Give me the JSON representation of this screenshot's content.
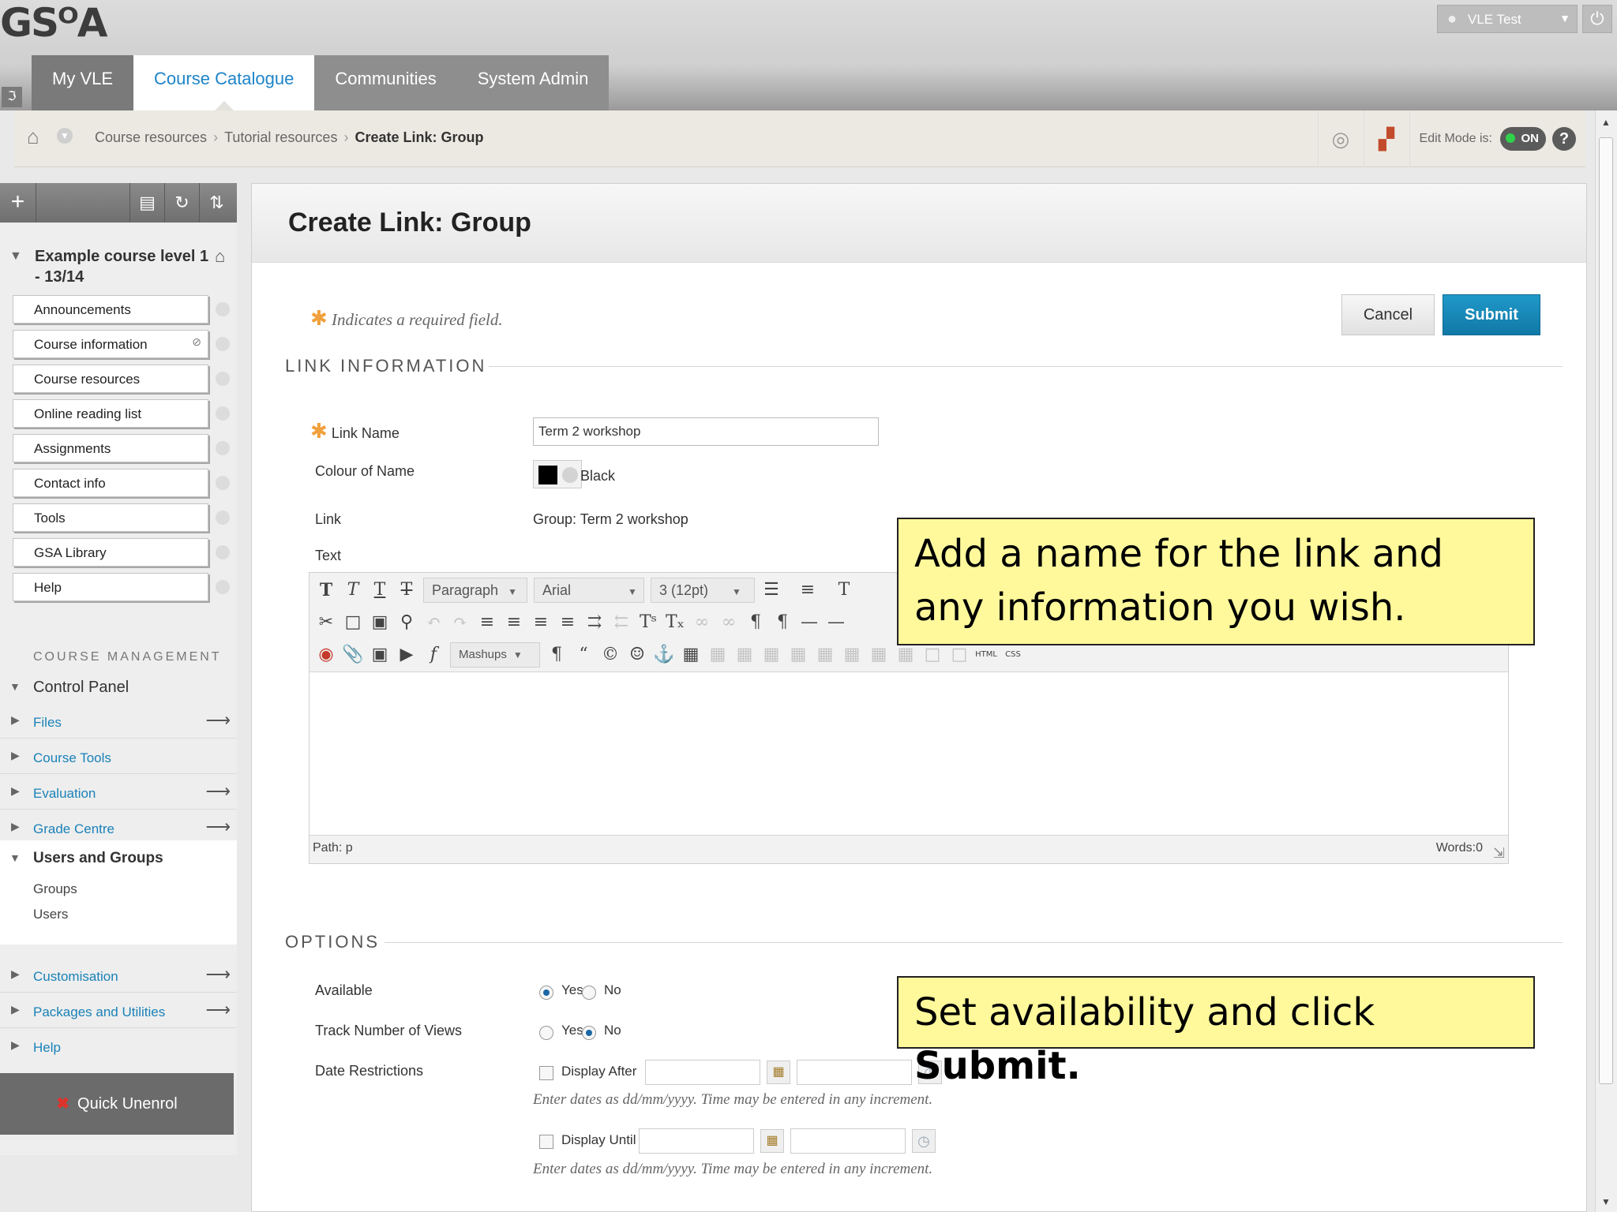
{
  "header": {
    "logo": "GSᴼA",
    "user_name": "VLE Test",
    "tabs": [
      "My VLE",
      "Course Catalogue",
      "Communities",
      "System Admin"
    ]
  },
  "breadcrumb": {
    "items": [
      "Course resources",
      "Tutorial resources"
    ],
    "current": "Create Link: Group",
    "edit_mode_label": "Edit Mode is:",
    "edit_mode_value": "ON"
  },
  "sidebar": {
    "course_title": "Example course level 1 - 13/14",
    "menu_items": [
      "Announcements",
      "Course information",
      "Course resources",
      "Online reading list",
      "Assignments",
      "Contact info",
      "Tools",
      "GSA Library",
      "Help"
    ],
    "management_heading": "COURSE MANAGEMENT",
    "control_panel_label": "Control Panel",
    "control_items": [
      "Files",
      "Course Tools",
      "Evaluation",
      "Grade Centre"
    ],
    "users_groups": {
      "label": "Users and Groups",
      "sub": [
        "Groups",
        "Users"
      ]
    },
    "bottom_items": [
      "Customisation",
      "Packages and Utilities",
      "Help"
    ],
    "quick_unenrol": "Quick Unenrol"
  },
  "main": {
    "title": "Create Link: Group",
    "required_note": "Indicates a required field.",
    "cancel_label": "Cancel",
    "submit_label": "Submit",
    "link_info_heading": "LINK INFORMATION",
    "fields": {
      "link_name_label": "Link Name",
      "link_name_value": "Term 2 workshop",
      "colour_label": "Colour of Name",
      "colour_value": "Black",
      "link_label": "Link",
      "link_value": "Group: Term 2 workshop",
      "text_label": "Text"
    },
    "editor": {
      "paragraph": "Paragraph",
      "font": "Arial",
      "size": "3 (12pt)",
      "mashups": "Mashups",
      "path": "Path: p",
      "words": "Words:0"
    },
    "options_heading": "OPTIONS",
    "options": {
      "available_label": "Available",
      "track_label": "Track Number of Views",
      "date_label": "Date Restrictions",
      "yes": "Yes",
      "no": "No",
      "display_after": "Display After",
      "display_until": "Display Until",
      "date_hint": "Enter dates as dd/mm/yyyy. Time may be entered in any increment."
    }
  },
  "callouts": {
    "first": "Add a name for the link and any information you wish.",
    "second_prefix": "Set availability and click ",
    "second_bold": "Submit."
  },
  "colors": {
    "accent": "#1d84c9",
    "submit": "#1178a6",
    "callout": "#fff99c"
  }
}
